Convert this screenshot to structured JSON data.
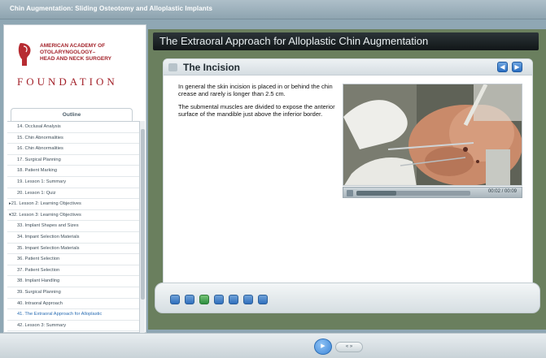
{
  "window": {
    "title": "Chin Augmentation: Sliding Osteotomy and Alloplastic Implants"
  },
  "logo": {
    "org_lines": [
      "AMERICAN ACADEMY OF",
      "OTOLARYNGOLOGY–",
      "HEAD AND NECK SURGERY"
    ],
    "foundation": "FOUNDATION"
  },
  "outline": {
    "tab_label": "Outline",
    "items": [
      "14. Occlusal Analysis",
      "15. Chin Abnormalities",
      "16. Chin Abnormalities",
      "17. Surgical Planning",
      "18. Patient Marking",
      "19. Lesson 1: Summary",
      "20. Lesson 1: Quiz",
      "▸21. Lesson 2: Learning Objectives",
      "▾32. Lesson 3: Learning Objectives",
      "33. Implant Shapes and Sizes",
      "34. Impant Selection Materials",
      "35. Impant Selection Materials",
      "36. Patient Selection",
      "37. Patient Selection",
      "38. Implant Handling",
      "39. Surgical Planning",
      "40. Intraoral Approach",
      "41. The Extraoral  Approach for Alloplastic",
      "42. Lesson 3: Summary"
    ],
    "active_index": 17
  },
  "main": {
    "heading": "The Extraoral  Approach for Alloplastic Chin Augmentation",
    "content_title": "The Incision",
    "paragraphs": [
      "In general the skin incision is placed in or behind the chin crease and rarely is longer than 2.5 cm.",
      "The submental muscles are divided to expose the anterior surface of the mandible just above the inferior border."
    ],
    "video": {
      "time": "00:02 / 00:09",
      "progress": 0.35
    }
  },
  "colors": {
    "accent": "#2a6db3",
    "brand": "#a3222a",
    "stage_bg": "#6a7f5e"
  },
  "footer": {
    "play_icon": "play-icon",
    "skip_label": "« »"
  }
}
